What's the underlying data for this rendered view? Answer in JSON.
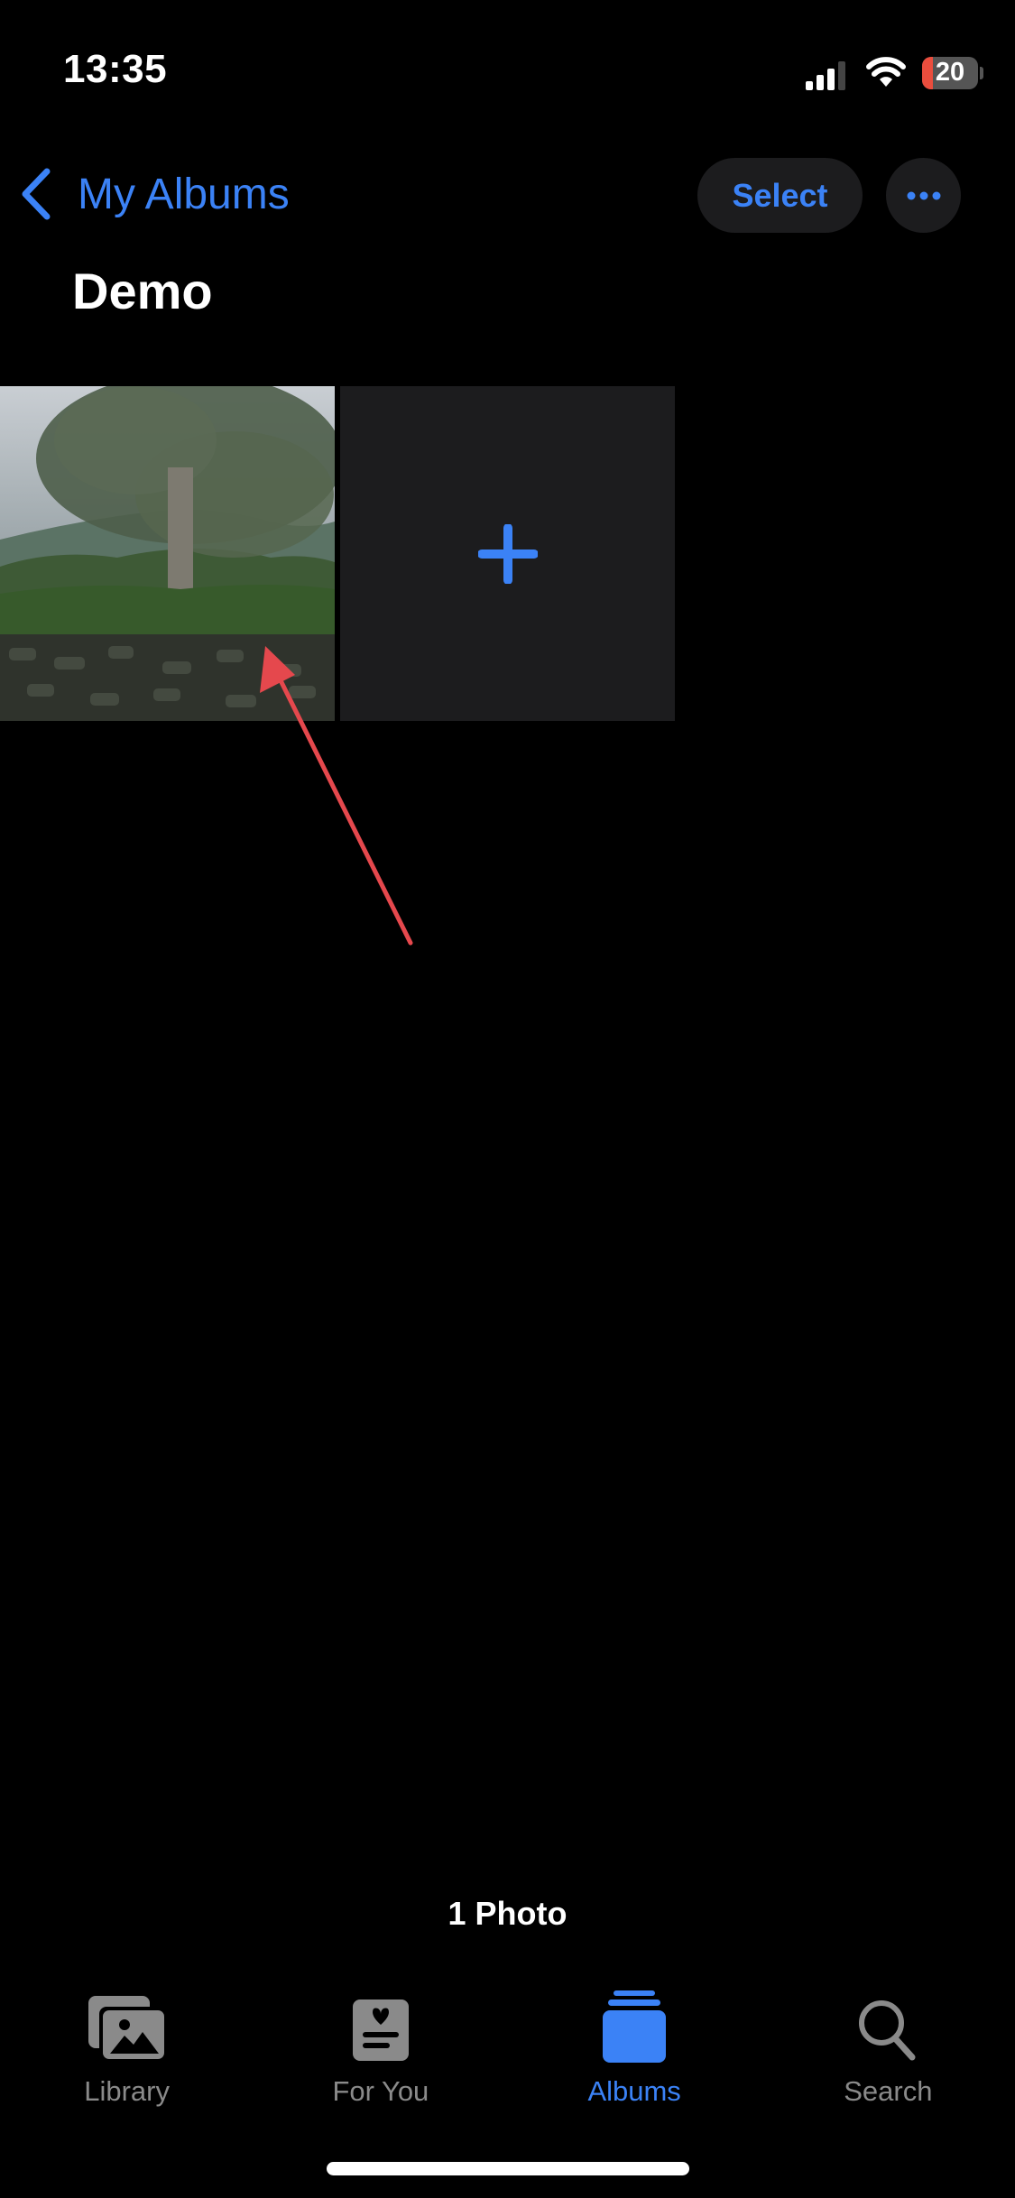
{
  "status_bar": {
    "time": "13:35",
    "battery_percent": "20",
    "battery_level": 0.2,
    "icons": [
      "cellular-signal-icon",
      "wifi-icon",
      "battery-icon"
    ]
  },
  "nav": {
    "back_label": "My Albums",
    "back_icon": "chevron-left-icon",
    "select_label": "Select",
    "more_icon": "ellipsis-icon"
  },
  "album": {
    "title": "Demo",
    "items": [
      {
        "type": "photo",
        "description": "Tree with hills and stone wall"
      },
      {
        "type": "add",
        "icon": "plus-icon"
      }
    ],
    "count_label": "1 Photo"
  },
  "tabbar": {
    "tabs": [
      {
        "label": "Library",
        "icon": "photo-library-icon",
        "active": false
      },
      {
        "label": "For You",
        "icon": "for-you-icon",
        "active": false
      },
      {
        "label": "Albums",
        "icon": "albums-icon",
        "active": true
      },
      {
        "label": "Search",
        "icon": "search-icon",
        "active": false
      }
    ]
  },
  "colors": {
    "accent": "#3b82f6",
    "background": "#000000",
    "surface": "#1c1c1e",
    "annotation_arrow": "#e5484d"
  }
}
